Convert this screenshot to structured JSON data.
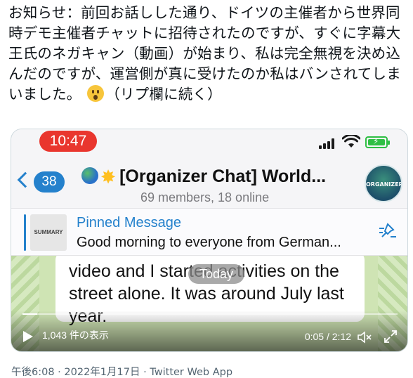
{
  "tweet": {
    "text_part1": "お知らせ：前回お話しした通り、ドイツの主催者から世界同時デモ主催者チャットに招待されたのですが、すぐに字幕大王氏のネガキャン（動画）が始まり、私は完全無視を決め込んだのですが、運営側が真に受けたのか私はバンされてしまいました。",
    "text_part2": "（リプ欄に続く）",
    "emoji": "hushed-face"
  },
  "video": {
    "status_time": "10:47",
    "back_count": "38",
    "chat_title": "[Organizer Chat] World...",
    "chat_subtitle": "69 members, 18 online",
    "group_avatar_text": "ORGANIZERS",
    "pinned_thumb_text": "SUMMARY",
    "pinned_label": "Pinned Message",
    "pinned_text": "Good morning to everyone from German...",
    "message_text": "video and I started activities on the\nstreet alone. It was around July last\nyear.",
    "today_label": "Today",
    "views": "1,043 件の表示",
    "timecode": "0:05 / 2:12",
    "progress": 0.04
  },
  "meta": {
    "timestamp": "午後6:08 · 2022年1月17日 · ",
    "app": "Twitter Web App"
  },
  "colors": {
    "telegram_blue": "#2481cc",
    "time_pill_red": "#e9362e",
    "battery_green": "#2fbf44",
    "chat_wallpaper": "#cfe4b4",
    "muted_text": "#536471"
  }
}
